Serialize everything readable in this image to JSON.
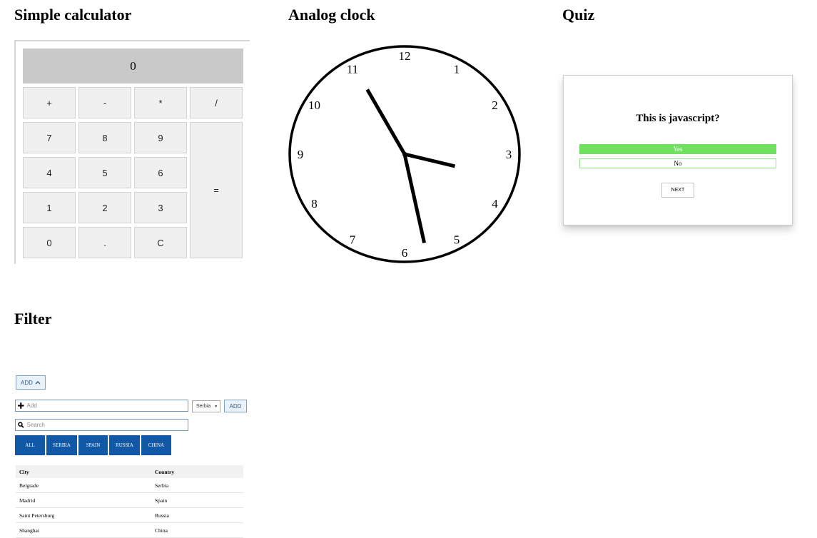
{
  "titles": {
    "calculator": "Simple calculator",
    "clock": "Analog clock",
    "quiz": "Quiz",
    "filter": "Filter"
  },
  "calculator": {
    "display": "0",
    "keys": {
      "plus": "+",
      "minus": "-",
      "multiply": "*",
      "divide": "/",
      "seven": "7",
      "eight": "8",
      "nine": "9",
      "equals": "=",
      "four": "4",
      "five": "5",
      "six": "6",
      "one": "1",
      "two": "2",
      "three": "3",
      "zero": "0",
      "dot": ".",
      "clear": "C"
    }
  },
  "clock": {
    "numerals": [
      "12",
      "1",
      "2",
      "3",
      "4",
      "5",
      "6",
      "7",
      "8",
      "9",
      "10",
      "11"
    ],
    "time": {
      "hour": 3,
      "minute": 27,
      "second": 55
    }
  },
  "quiz": {
    "question": "This is javascript?",
    "answers": [
      {
        "label": "Yes",
        "selected": true
      },
      {
        "label": "No",
        "selected": false
      }
    ],
    "next_label": "NEXT",
    "colors": {
      "selected": "#72e05f"
    }
  },
  "filter": {
    "add_toggle_label": "ADD",
    "add_placeholder": "Add",
    "country_select_value": "Serbia",
    "add_button_label": "ADD",
    "search_placeholder": "Search",
    "tabs": [
      "ALL",
      "SERBIA",
      "SPAIN",
      "RUSSIA",
      "CHINA"
    ],
    "table": {
      "headers": [
        "City",
        "Country"
      ],
      "rows": [
        [
          "Belgrade",
          "Serbia"
        ],
        [
          "Madrid",
          "Spain"
        ],
        [
          "Saint Petersburg",
          "Russia"
        ],
        [
          "Shanghai",
          "China"
        ]
      ]
    },
    "colors": {
      "tab": "#1158a7"
    }
  }
}
